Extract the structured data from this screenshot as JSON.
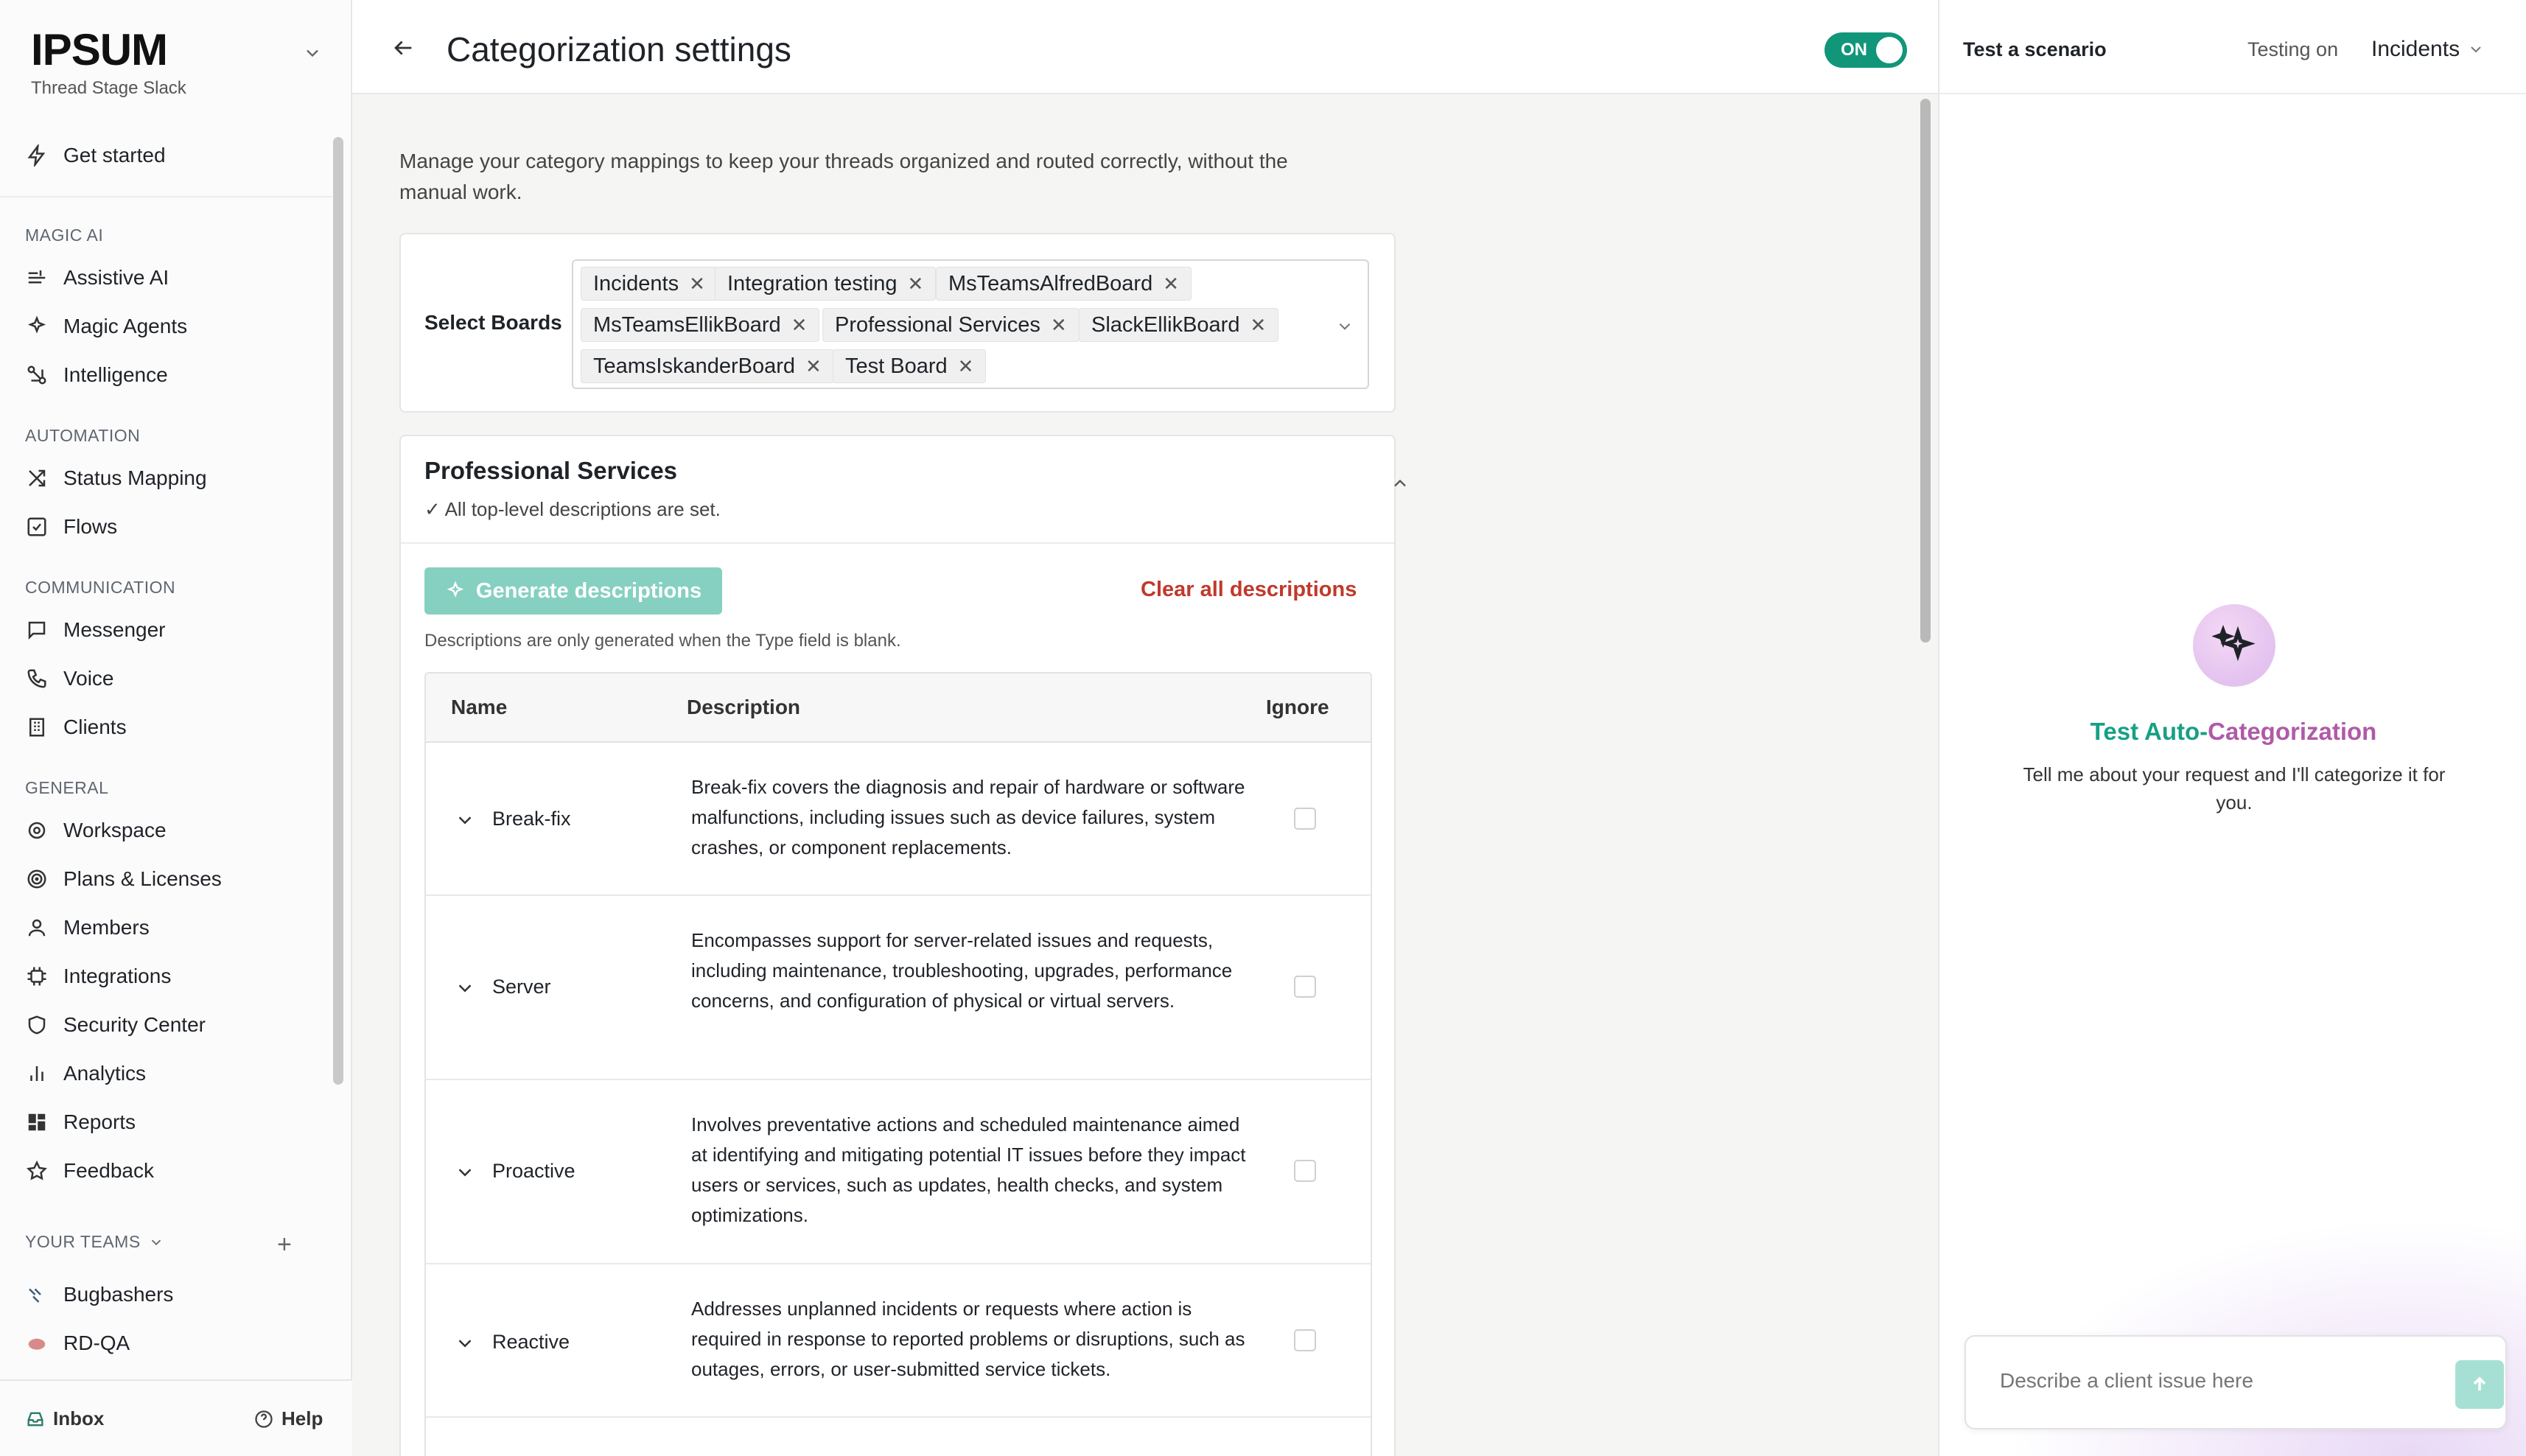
{
  "sidebar": {
    "brand": "IPSUM",
    "workspace": "Thread Stage Slack",
    "get_started": "Get started",
    "sections": [
      {
        "label": "MAGIC AI",
        "items": [
          "Assistive AI",
          "Magic Agents",
          "Intelligence"
        ]
      },
      {
        "label": "AUTOMATION",
        "items": [
          "Status Mapping",
          "Flows"
        ]
      },
      {
        "label": "COMMUNICATION",
        "items": [
          "Messenger",
          "Voice",
          "Clients"
        ]
      },
      {
        "label": "GENERAL",
        "items": [
          "Workspace",
          "Plans & Licenses",
          "Members",
          "Integrations",
          "Security Center",
          "Analytics",
          "Reports",
          "Feedback"
        ]
      }
    ],
    "teams_label": "YOUR TEAMS",
    "teams": [
      "Bugbashers",
      "RD-QA"
    ],
    "footer": {
      "inbox": "Inbox",
      "help": "Help"
    }
  },
  "header": {
    "title": "Categorization settings",
    "toggle": "ON"
  },
  "main": {
    "intro": "Manage your category mappings to keep your threads organized and routed correctly, without the manual work.",
    "boards_label": "Select Boards",
    "boards": [
      "Incidents",
      "Integration testing",
      "MsTeamsAlfredBoard",
      "MsTeamsEllikBoard",
      "Professional Services",
      "SlackEllikBoard",
      "TeamsIskanderBoard",
      "Test Board"
    ],
    "section": {
      "title": "Professional Services",
      "status": "All top-level descriptions are set.",
      "generate": "Generate descriptions",
      "clear": "Clear all descriptions",
      "note": "Descriptions are only generated when the Type field is blank.",
      "columns": [
        "Name",
        "Description",
        "Ignore"
      ],
      "rows": [
        {
          "name": "Break-fix",
          "description": "Break-fix covers the diagnosis and repair of hardware or software malfunctions, including issues such as device failures, system crashes, or component replacements."
        },
        {
          "name": "Server",
          "description": "Encompasses support for server-related issues and requests, including maintenance, troubleshooting, upgrades, performance concerns, and configuration of physical or virtual servers."
        },
        {
          "name": "Proactive",
          "description": "Involves preventative actions and scheduled maintenance aimed at identifying and mitigating potential IT issues before they impact users or services, such as updates, health checks, and system optimizations."
        },
        {
          "name": "Reactive",
          "description": "Addresses unplanned incidents or requests where action is required in response to reported problems or disruptions, such as outages, errors, or user-submitted service tickets."
        }
      ]
    }
  },
  "right_panel": {
    "title": "Test a scenario",
    "testing_on": "Testing on",
    "board": "Incidents",
    "test_title_a": "Test Auto-",
    "test_title_b": "Categorization",
    "test_sub": "Tell me about your request and I'll categorize it for you.",
    "input_placeholder": "Describe a client issue here"
  },
  "colors": {
    "accent": "#11967a",
    "danger": "#c0392b",
    "gen_button": "#86d0c2"
  }
}
